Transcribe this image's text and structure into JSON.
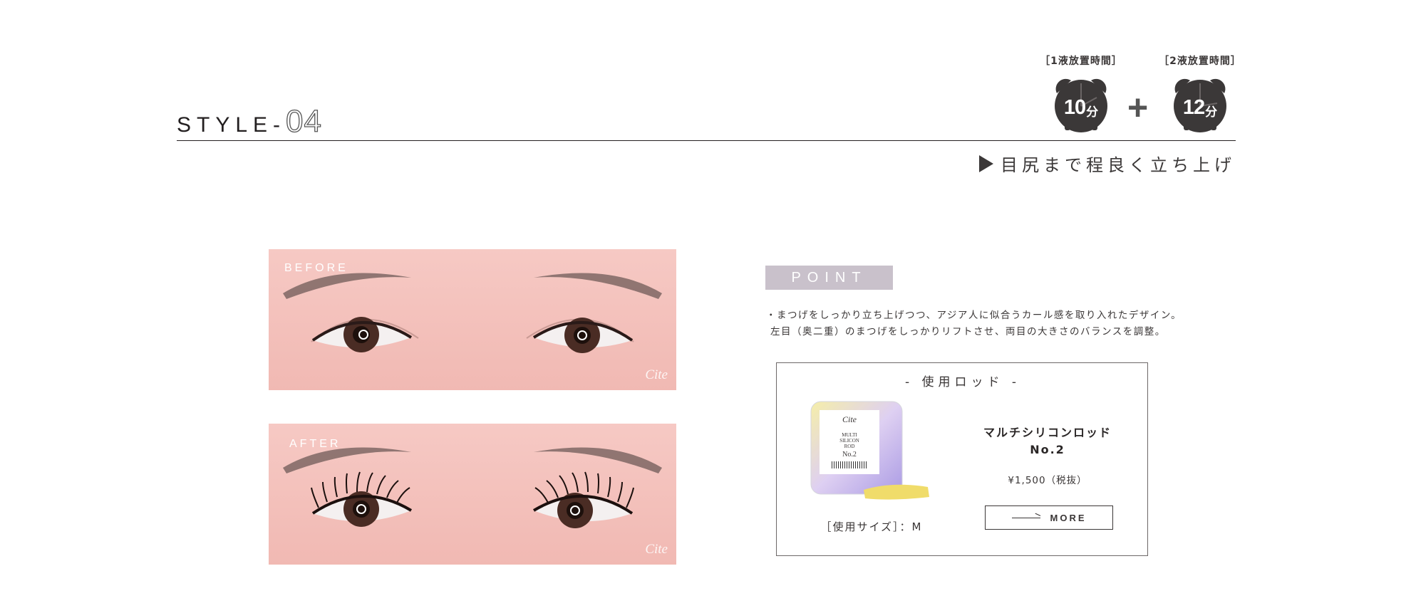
{
  "header": {
    "style_prefix": "STYLE-",
    "style_number": "04",
    "subtitle": "目尻まで程良く立ち上げ"
  },
  "timers": [
    {
      "label": "［1液放置時間］",
      "minutes": "10",
      "unit": "分"
    },
    {
      "label": "［2液放置時間］",
      "minutes": "12",
      "unit": "分"
    }
  ],
  "timer_plus": "+",
  "photos": {
    "before_label": "BEFORE",
    "after_label": "AFTER",
    "watermark": "Cite"
  },
  "point": {
    "badge": "POINT",
    "lines": [
      "・まつげをしっかり立ち上げつつ、アジア人に似合うカール感を取り入れたデザイン。",
      "左目（奥二重）のまつげをしっかりリフトさせ、両目の大きさのバランスを調整。"
    ]
  },
  "rod": {
    "heading": "- 使用ロッド -",
    "name_line1": "マルチシリコンロッド",
    "name_line2": "No.2",
    "price": "¥1,500（税抜）",
    "size": "［使用サイズ］：M",
    "more_label": "MORE",
    "package": {
      "brand": "Cite",
      "line1": "MULTI",
      "line2": "SILICON",
      "line3": "ROD",
      "number": "No.2"
    }
  },
  "colors": {
    "clock": "#3b3838",
    "badge_bg": "#c9c1cb",
    "skin": "#f3c2bc",
    "text": "#3a3636"
  }
}
